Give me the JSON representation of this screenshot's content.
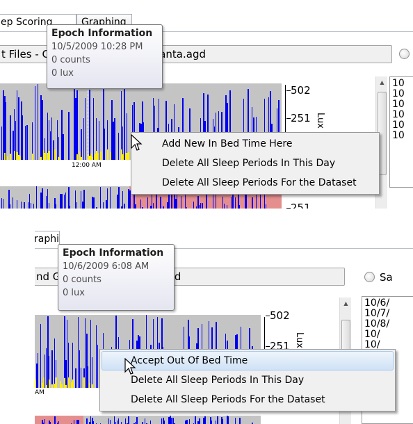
{
  "colors": {
    "chart_background": "#c4c4c4",
    "activity_counts": "#0000ee",
    "light_lux": "#ffee00",
    "sleep_period_band": "#e58e8e",
    "menu_highlight": "#cfe2f6"
  },
  "top_panel": {
    "tabs": [
      "ep Scoring",
      "Graphing"
    ],
    "file_path": "t Files - C:\\test AGD files\\HKAtlanta.agd",
    "tooltip": {
      "title": "Epoch Information",
      "datetime": "10/5/2009 10:28 PM",
      "counts": "0 counts",
      "lux": "0 lux"
    },
    "chart": {
      "y_ticks": [
        "502",
        "251",
        "251"
      ],
      "y_axis_label": "Lux",
      "x_time_label": "12:00 AM"
    },
    "list_items": [
      "10",
      "10",
      "10",
      "10",
      "10",
      "10"
    ],
    "context_menu": [
      "Add New In Bed Time Here",
      "Delete All Sleep Periods In This Day",
      "Delete All Sleep Periods For the Dataset"
    ]
  },
  "bottom_panel": {
    "tabs": [
      "raphi"
    ],
    "file_path": "nd Grap files\\HKAtlanta.agd",
    "radio_label": "Sa",
    "tooltip": {
      "title": "Epoch Information",
      "datetime": "10/6/2009 6:08 AM",
      "counts": "0 counts",
      "lux": "0 lux"
    },
    "chart": {
      "y_ticks": [
        "502",
        "251"
      ],
      "y_axis_label": "Lux",
      "x_time_label": "AM"
    },
    "list_items": [
      "10/6/",
      "10/7/",
      "10/8/",
      "10/",
      "10/",
      "10/",
      "10/"
    ],
    "context_menu": [
      "Accept Out Of Bed Time",
      "Delete All Sleep Periods In This Day",
      "Delete All Sleep Periods For the Dataset"
    ],
    "hovered_item_index": 0
  }
}
